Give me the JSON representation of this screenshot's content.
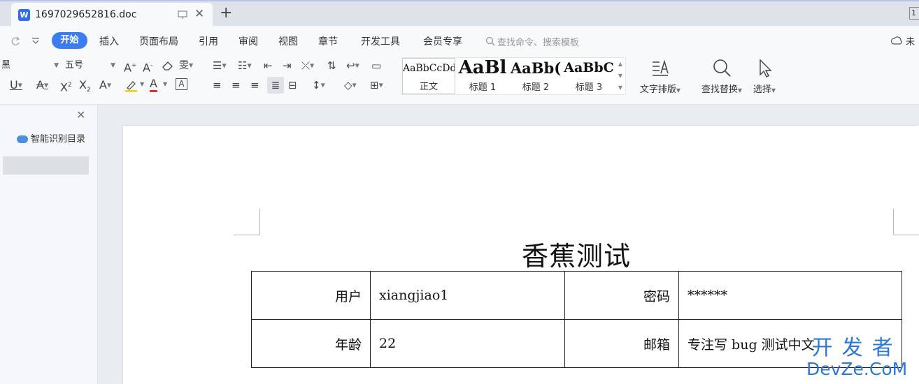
{
  "tabbar": {
    "doc_icon": "W",
    "doc_title": "1697029652816.doc",
    "close_glyph": "✕",
    "new_tab_glyph": "+",
    "window_badge": "1"
  },
  "menu": {
    "start": "开始",
    "items": [
      "插入",
      "页面布局",
      "引用",
      "审阅",
      "视图",
      "章节",
      "开发工具",
      "会员专享"
    ],
    "search": "查找命令、搜索模板",
    "account": "未"
  },
  "format": {
    "font_name": "黑",
    "font_size": "五号"
  },
  "styles": {
    "items": [
      {
        "sample": "AaBbCcDd",
        "name": "正文"
      },
      {
        "sample": "AaBl",
        "name": "标题 1"
      },
      {
        "sample": "AaBb(",
        "name": "标题 2"
      },
      {
        "sample": "AaBbC",
        "name": "标题 3"
      }
    ]
  },
  "tools": {
    "text_layout": "文字排版",
    "find_replace": "查找替换",
    "select": "选择"
  },
  "left_pane": {
    "close_glyph": "✕",
    "toc_button": "智能识别目录"
  },
  "document": {
    "heading": "香蕉测试",
    "rows": [
      {
        "label1": "用户",
        "value1": "xiangjiao1",
        "label2": "密码",
        "value2": "******"
      },
      {
        "label1": "年龄",
        "value1": "22",
        "label2": "邮箱",
        "value2": "专注写 bug 测试中文"
      }
    ]
  },
  "watermark": {
    "top": "开发者",
    "bottom": "DevZe.CoM"
  },
  "colors": {
    "accent": "#3b7cf0",
    "watermark": "#2d78d6"
  }
}
